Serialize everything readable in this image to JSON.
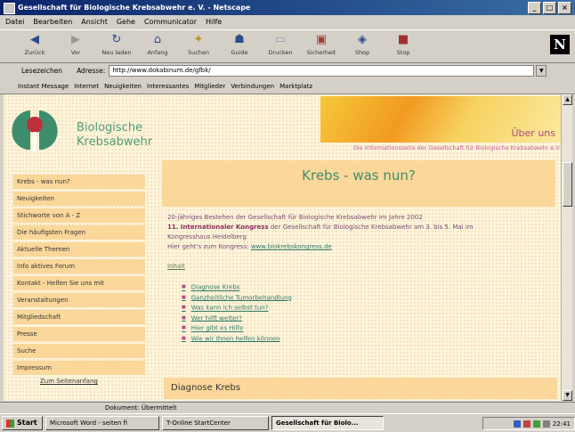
{
  "window": {
    "title": "Gesellschaft für Biologische Krebsabwehr e. V. - Netscape",
    "controls": [
      "_",
      "□",
      "×"
    ]
  },
  "menu": [
    "Datei",
    "Bearbeiten",
    "Ansicht",
    "Gehe",
    "Communicator",
    "Hilfe"
  ],
  "toolbar": [
    "Zurück",
    "Vor",
    "Neu laden",
    "Anfang",
    "Suchen",
    "Guide",
    "Drucken",
    "Sicherheit",
    "Shop",
    "Stop"
  ],
  "brand_logo": "N",
  "location": {
    "bookmarks_label": "Lesezeichen",
    "address_label": "Adresse:",
    "url": "http://www.dokabinum.de/gfbk/"
  },
  "personal_toolbar": [
    "Instant Message",
    "Internet",
    "Neuigkeiten",
    "Interessantes",
    "Mitglieder",
    "Verbindungen",
    "Marktplatz"
  ],
  "site": {
    "logo_text_line1": "Biologische",
    "logo_text_line2": "Krebsabwehr",
    "banner_text": "Über uns",
    "tagline": "Die Informationsseite der Gesellschaft für Biologische Krebsabwehr e.V.",
    "nav": [
      "Krebs - was nun?",
      "Neuigkeiten",
      "Stichworte von A - Z",
      "Die häufigsten Fragen",
      "Aktuelle Themen",
      "Info aktives Forum",
      "Kontakt - Helfen Sie uns mit",
      "Veranstaltungen",
      "Mitgliedschaft",
      "Presse",
      "Suche",
      "Impressum"
    ],
    "nav_link": "Zum Seitenanfang",
    "heading": "Krebs - was nun?",
    "intro_1": "20-jähriges Bestehen der Gesellschaft für Biologische Krebsabwehr im Jahre 2002",
    "intro_2_bold": "11. Internationaler Kongress",
    "intro_2_rest": " der Gesellschaft für Biologische Krebsabwehr am 3. bis 5. Mai im",
    "intro_3": "Kongresshaus Heidelberg",
    "intro_4": "Hier geht's zum Kongress: ",
    "intro_link": "www.biokrebskongress.de",
    "inhalt": "Inhalt",
    "toc": [
      "Diagnose Krebs",
      "Ganzheitliche Tumorbehandlung",
      "Was kann ich selbst tun?",
      "Wer hilft weiter?",
      "Hier gibt es Hilfe",
      "Wie wir Ihnen helfen können"
    ],
    "section_heading": "Diagnose Krebs"
  },
  "status": "Dokument: Übermittelt",
  "taskbar": {
    "start": "Start",
    "tasks": [
      "Microsoft Word - seiten fi",
      "T-Online StartCenter",
      "Gesellschaft für Biolo..."
    ],
    "clock": "22:41"
  },
  "colors": {
    "accent_green": "#3e8e6e",
    "nav_bg": "#fbd79a",
    "logo_red": "#c0303a",
    "link_green": "#2e7a6a"
  }
}
